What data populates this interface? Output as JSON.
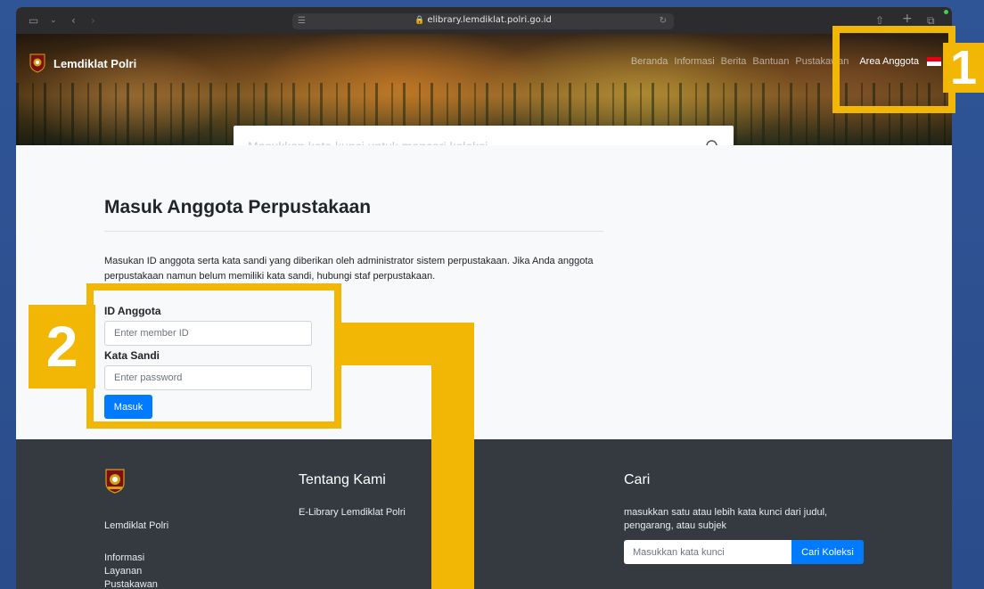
{
  "browser": {
    "url": "elibrary.lemdiklat.polri.go.id"
  },
  "header": {
    "brand": "Lemdiklat Polri",
    "nav": [
      {
        "label": "Beranda"
      },
      {
        "label": "Informasi"
      },
      {
        "label": "Berita"
      },
      {
        "label": "Bantuan"
      },
      {
        "label": "Pustakawan"
      }
    ],
    "member_area": "Area Anggota",
    "search_placeholder": "Masukkan kata kunci untuk mencari koleksi..."
  },
  "login": {
    "title": "Masuk Anggota Perpustakaan",
    "intro": "Masukan ID anggota serta kata sandi yang diberikan oleh administrator sistem perpustakaan. Jika Anda anggota perpustakaan namun belum memiliki kata sandi, hubungi staf perpustakaan.",
    "member_id_label": "ID Anggota",
    "member_id_placeholder": "Enter member ID",
    "password_label": "Kata Sandi",
    "password_placeholder": "Enter password",
    "submit": "Masuk"
  },
  "footer": {
    "org_name": "Lemdiklat Polri",
    "links": [
      "Informasi",
      "Layanan",
      "Pustakawan"
    ],
    "about_title": "Tentang Kami",
    "about_text": "E-Library Lemdiklat Polri",
    "search_title": "Cari",
    "search_text": "masukkan satu atau lebih kata kunci dari judul, pengarang, atau subjek",
    "search_placeholder": "Masukkan kata kunci",
    "search_button": "Cari Koleksi"
  },
  "annotations": {
    "badge_1": "1",
    "badge_2": "2",
    "color": "#f2b705"
  },
  "colors": {
    "primary": "#007bff",
    "footer_bg": "#343a40",
    "backdrop": "#2d4f8e"
  }
}
